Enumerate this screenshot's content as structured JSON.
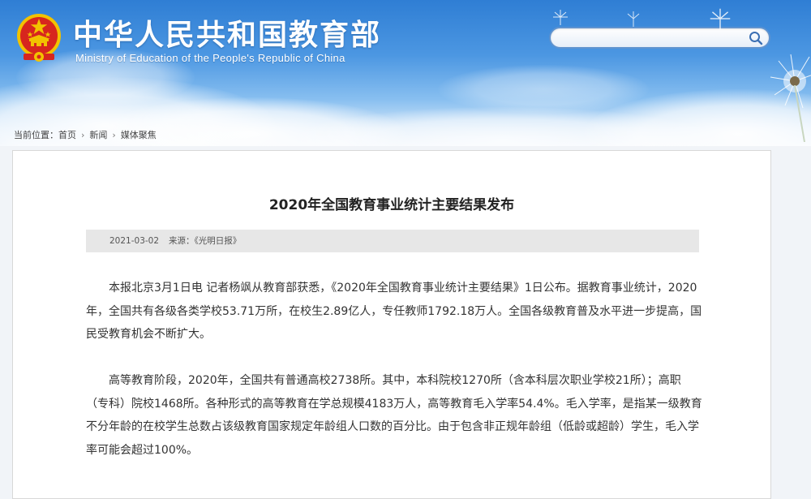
{
  "header": {
    "title": "中华人民共和国教育部",
    "subtitle": "Ministry of Education of the People's Republic of China",
    "emblem_icon": "national-emblem-icon",
    "search": {
      "placeholder": "",
      "icon": "search-icon"
    }
  },
  "breadcrumb": {
    "label": "当前位置：",
    "items": [
      "首页",
      "新闻",
      "媒体聚焦"
    ],
    "separator": "›"
  },
  "article": {
    "title": "2020年全国教育事业统计主要结果发布",
    "date": "2021-03-02",
    "source": "来源：《光明日报》",
    "paragraphs": [
      "本报北京3月1日电 记者杨飒从教育部获悉，《2020年全国教育事业统计主要结果》1日公布。据教育事业统计，2020年，全国共有各级各类学校53.71万所，在校生2.89亿人，专任教师1792.18万人。全国各级教育普及水平进一步提高，国民受教育机会不断扩大。",
      "高等教育阶段，2020年，全国共有普通高校2738所。其中，本科院校1270所（含本科层次职业学校21所）；高职（专科）院校1468所。各种形式的高等教育在学总规模4183万人，高等教育毛入学率54.4%。毛入学率，是指某一级教育不分年龄的在校学生总数占该级教育国家规定年龄组人口数的百分比。由于包含非正规年龄组（低龄或超龄）学生，毛入学率可能会超过100%。"
    ]
  },
  "colors": {
    "banner_top": "#2f7ed4",
    "banner_bottom": "#eef4fb",
    "emblem_red": "#d7261e",
    "emblem_gold": "#f2c200",
    "search_border": "#5f93cf",
    "meta_bar": "#e7e7e7",
    "text": "#333333"
  }
}
